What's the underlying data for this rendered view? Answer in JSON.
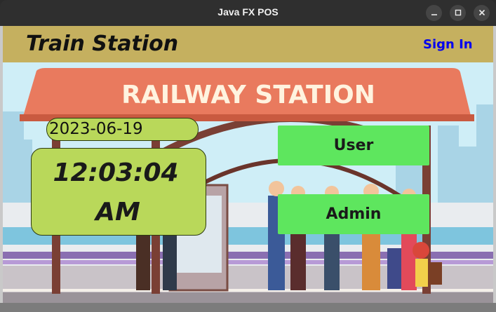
{
  "window": {
    "title": "Java FX POS"
  },
  "header": {
    "title": "Train Station",
    "sign_in": "Sign In"
  },
  "scene": {
    "sign_text": "RAILWAY STATION"
  },
  "clock": {
    "date": "2023-06-19",
    "time": "12:03:04",
    "ampm": "AM"
  },
  "actions": {
    "user_label": "User",
    "admin_label": "Admin"
  },
  "colors": {
    "header_bg": "#c5b05f",
    "clock_bg": "#b9d85a",
    "button_bg": "#5ee65e",
    "link": "#0000ee"
  }
}
